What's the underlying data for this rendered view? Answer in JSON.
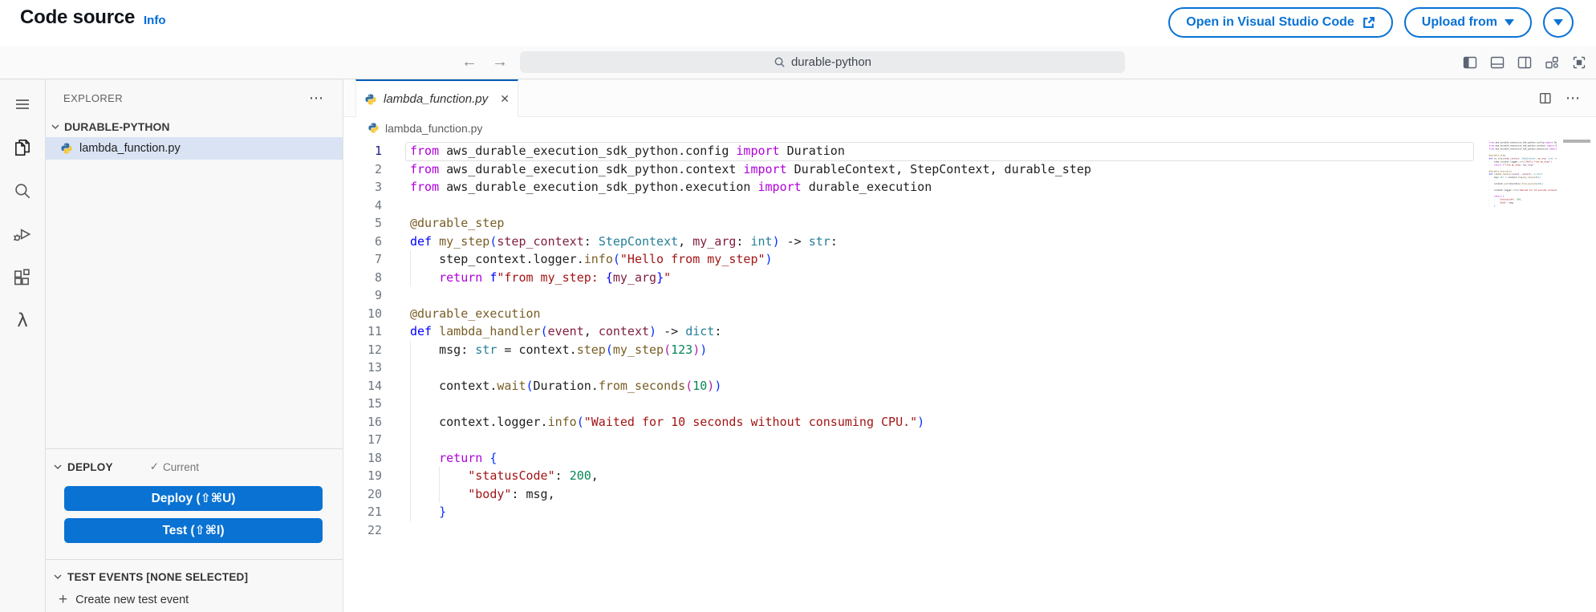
{
  "colors": {
    "accent": "#0972d3",
    "tab_accent": "#005fb8",
    "selection": "#d9e3f3",
    "tokens": {
      "k": "#af00db",
      "d": "#0000ff",
      "fn": "#795e26",
      "p": "#811f3f",
      "t": "#267f99",
      "s": "#a31515",
      "n": "#098658",
      "b1": "#0431fa",
      "b2": "#a626a4",
      "tx": "#1f1f1f"
    }
  },
  "header": {
    "title": "Code source",
    "info": "Info",
    "open_vscode": "Open in Visual Studio Code",
    "upload_from": "Upload from"
  },
  "toolbar": {
    "back": "←",
    "forward": "→",
    "search_value": "durable-python"
  },
  "explorer": {
    "title": "EXPLORER",
    "more": "⋯",
    "folder": "DURABLE-PYTHON",
    "file": "lambda_function.py",
    "deploy": {
      "title": "DEPLOY",
      "check": "✓",
      "status": "Current",
      "deploy_button": "Deploy (⇧⌘U)",
      "test_button": "Test (⇧⌘I)"
    },
    "test_events": {
      "title": "TEST EVENTS [NONE SELECTED]",
      "plus": "+",
      "create": "Create new test event"
    }
  },
  "editor": {
    "tab_title": "lambda_function.py",
    "tab_close": "✕",
    "tab_more": "⋯",
    "breadcrumb": "lambda_function.py",
    "lambda_icon_glyph": "λ",
    "code": {
      "language": "python",
      "current_line": 1,
      "lines": [
        {
          "g": [],
          "t": [
            [
              "k",
              "from"
            ],
            [
              "tx",
              " aws_durable_execution_sdk_python.config "
            ],
            [
              "k",
              "import"
            ],
            [
              "tx",
              " Duration"
            ]
          ]
        },
        {
          "g": [],
          "t": [
            [
              "k",
              "from"
            ],
            [
              "tx",
              " aws_durable_execution_sdk_python.context "
            ],
            [
              "k",
              "import"
            ],
            [
              "tx",
              " DurableContext, StepContext, durable_step"
            ]
          ]
        },
        {
          "g": [],
          "t": [
            [
              "k",
              "from"
            ],
            [
              "tx",
              " aws_durable_execution_sdk_python.execution "
            ],
            [
              "k",
              "import"
            ],
            [
              "tx",
              " durable_execution"
            ]
          ]
        },
        {
          "g": [],
          "t": []
        },
        {
          "g": [],
          "t": [
            [
              "fn",
              "@durable_step"
            ]
          ]
        },
        {
          "g": [],
          "t": [
            [
              "d",
              "def "
            ],
            [
              "fn",
              "my_step"
            ],
            [
              "b1",
              "("
            ],
            [
              "p",
              "step_context"
            ],
            [
              "tx",
              ": "
            ],
            [
              "t",
              "StepContext"
            ],
            [
              "tx",
              ", "
            ],
            [
              "p",
              "my_arg"
            ],
            [
              "tx",
              ": "
            ],
            [
              "t",
              "int"
            ],
            [
              "b1",
              ")"
            ],
            [
              "tx",
              " -> "
            ],
            [
              "t",
              "str"
            ],
            [
              "tx",
              ":"
            ]
          ]
        },
        {
          "g": [
            0
          ],
          "t": [
            [
              "tx",
              "    step_context.logger."
            ],
            [
              "fn",
              "info"
            ],
            [
              "b1",
              "("
            ],
            [
              "s",
              "\"Hello from my_step\""
            ],
            [
              "b1",
              ")"
            ]
          ]
        },
        {
          "g": [
            0
          ],
          "t": [
            [
              "k",
              "    return"
            ],
            [
              "tx",
              " "
            ],
            [
              "d",
              "f"
            ],
            [
              "s",
              "\"from my_step: "
            ],
            [
              "d",
              "{"
            ],
            [
              "p",
              "my_arg"
            ],
            [
              "d",
              "}"
            ],
            [
              "s",
              "\""
            ]
          ]
        },
        {
          "g": [],
          "t": []
        },
        {
          "g": [],
          "t": [
            [
              "fn",
              "@durable_execution"
            ]
          ]
        },
        {
          "g": [],
          "t": [
            [
              "d",
              "def "
            ],
            [
              "fn",
              "lambda_handler"
            ],
            [
              "b1",
              "("
            ],
            [
              "p",
              "event"
            ],
            [
              "tx",
              ", "
            ],
            [
              "p",
              "context"
            ],
            [
              "b1",
              ")"
            ],
            [
              "tx",
              " -> "
            ],
            [
              "t",
              "dict"
            ],
            [
              "tx",
              ":"
            ]
          ]
        },
        {
          "g": [
            0
          ],
          "t": [
            [
              "tx",
              "    msg: "
            ],
            [
              "t",
              "str"
            ],
            [
              "tx",
              " = context."
            ],
            [
              "fn",
              "step"
            ],
            [
              "b1",
              "("
            ],
            [
              "fn",
              "my_step"
            ],
            [
              "b2",
              "("
            ],
            [
              "n",
              "123"
            ],
            [
              "b2",
              ")"
            ],
            [
              "b1",
              ")"
            ]
          ]
        },
        {
          "g": [
            0
          ],
          "t": []
        },
        {
          "g": [
            0
          ],
          "t": [
            [
              "tx",
              "    context."
            ],
            [
              "fn",
              "wait"
            ],
            [
              "b1",
              "("
            ],
            [
              "tx",
              "Duration."
            ],
            [
              "fn",
              "from_seconds"
            ],
            [
              "b2",
              "("
            ],
            [
              "n",
              "10"
            ],
            [
              "b2",
              ")"
            ],
            [
              "b1",
              ")"
            ]
          ]
        },
        {
          "g": [
            0
          ],
          "t": []
        },
        {
          "g": [
            0
          ],
          "t": [
            [
              "tx",
              "    context.logger."
            ],
            [
              "fn",
              "info"
            ],
            [
              "b1",
              "("
            ],
            [
              "s",
              "\"Waited for 10 seconds without consuming CPU.\""
            ],
            [
              "b1",
              ")"
            ]
          ]
        },
        {
          "g": [
            0
          ],
          "t": []
        },
        {
          "g": [
            0
          ],
          "t": [
            [
              "k",
              "    return"
            ],
            [
              "tx",
              " "
            ],
            [
              "b1",
              "{"
            ]
          ]
        },
        {
          "g": [
            0,
            4
          ],
          "t": [
            [
              "tx",
              "        "
            ],
            [
              "s",
              "\"statusCode\""
            ],
            [
              "tx",
              ": "
            ],
            [
              "n",
              "200"
            ],
            [
              "tx",
              ","
            ]
          ]
        },
        {
          "g": [
            0,
            4
          ],
          "t": [
            [
              "tx",
              "        "
            ],
            [
              "s",
              "\"body\""
            ],
            [
              "tx",
              ": msg,"
            ]
          ]
        },
        {
          "g": [
            0
          ],
          "t": [
            [
              "tx",
              "    "
            ],
            [
              "b1",
              "}"
            ]
          ]
        },
        {
          "g": [],
          "t": []
        }
      ]
    }
  }
}
